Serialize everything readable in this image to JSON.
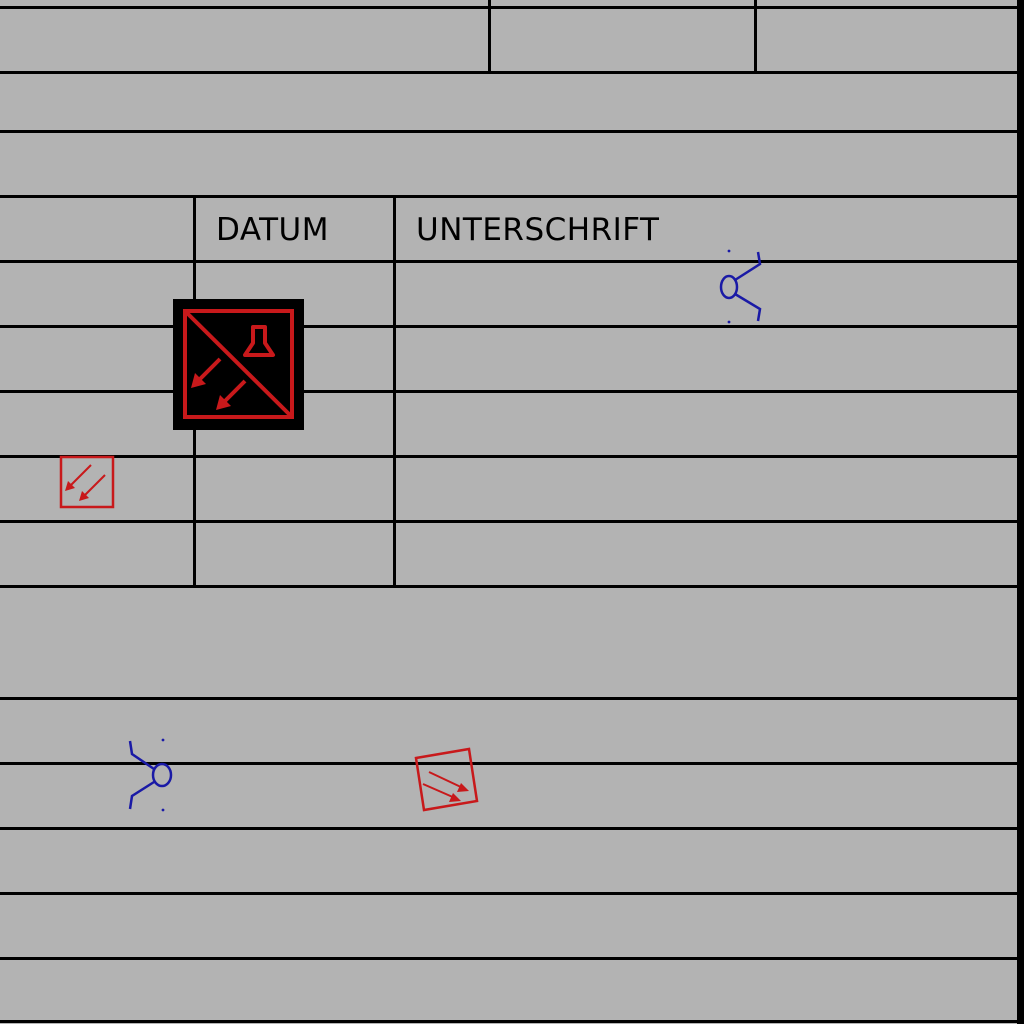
{
  "table": {
    "col_date_header": "DATUM",
    "col_signature_header": "UNTERSCHRIFT"
  },
  "colors": {
    "background": "#b3b3b3",
    "lines": "#000000",
    "symbol_red": "#c8191b",
    "symbol_blue": "#1a1aa6"
  },
  "symbols": [
    {
      "icon": "electrical-hazard-symbol-icon"
    },
    {
      "icon": "double-arrow-square-icon"
    },
    {
      "icon": "stick-figure-icon"
    }
  ]
}
